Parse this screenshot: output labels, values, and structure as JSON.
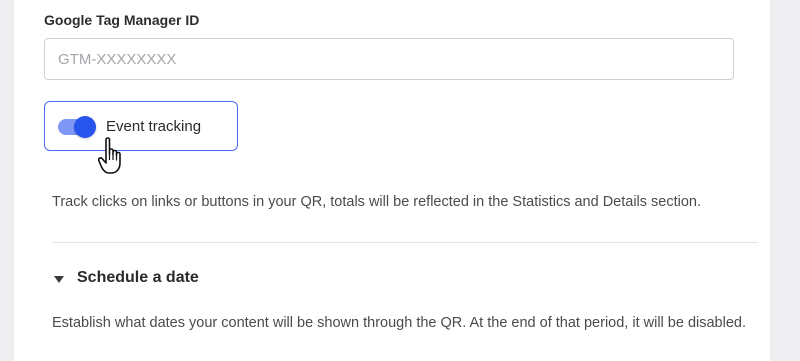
{
  "gtm": {
    "label": "Google Tag Manager ID",
    "placeholder": "GTM-XXXXXXXX",
    "value": ""
  },
  "event_tracking": {
    "label": "Event tracking",
    "enabled": true,
    "description": "Track clicks on links or buttons in your QR, totals will be reflected in the Statistics and Details section."
  },
  "schedule": {
    "title": "Schedule a date",
    "expanded": true,
    "description": "Establish what dates your content will be shown through the QR. At the end of that period, it will be disabled."
  },
  "colors": {
    "accent": "#2854ee",
    "toggle_track": "#7f97f6",
    "border": "#cfcfd4"
  },
  "icons": {
    "cursor": "hand-pointer-icon",
    "caret": "caret-down-icon"
  }
}
